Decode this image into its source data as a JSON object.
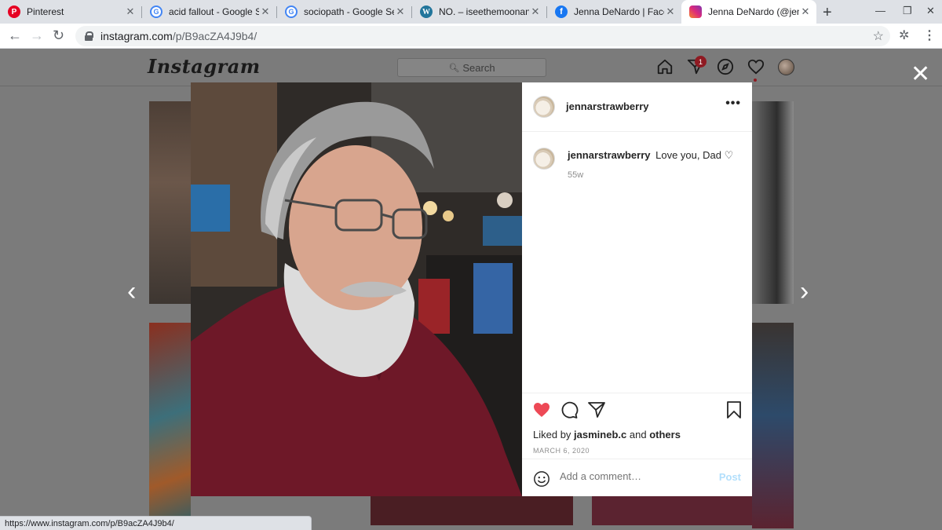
{
  "browser": {
    "tabs": [
      {
        "title": "Pinterest",
        "favicon": "pinterest-icon"
      },
      {
        "title": "acid fallout - Google Sea",
        "favicon": "google-icon"
      },
      {
        "title": "sociopath - Google Searc",
        "favicon": "google-icon"
      },
      {
        "title": "NO. – iseethemoonandt",
        "favicon": "wordpress-icon"
      },
      {
        "title": "Jenna DeNardo | Facebo",
        "favicon": "facebook-icon"
      },
      {
        "title": "Jenna DeNardo (@jenna",
        "favicon": "instagram-icon",
        "active": true
      }
    ],
    "url_host": "instagram.com",
    "url_path": "/p/B9acZA4J9b4/",
    "status_url": "https://www.instagram.com/p/B9acZA4J9b4/"
  },
  "instagram": {
    "logo": "Instagram",
    "search_placeholder": "Search",
    "notification_count": "1"
  },
  "post": {
    "username": "jennarstrawberry",
    "caption_user": "jennarstrawberry",
    "caption_text": "Love you, Dad ♡",
    "time_ago": "55w",
    "liked_by_prefix": "Liked by",
    "liked_by_user": "jasmineb.c",
    "liked_by_and": "and",
    "liked_by_others": "others",
    "date": "MARCH 6, 2020",
    "comment_placeholder": "Add a comment…",
    "post_label": "Post",
    "liked": true,
    "like_color": "#ed4956"
  }
}
